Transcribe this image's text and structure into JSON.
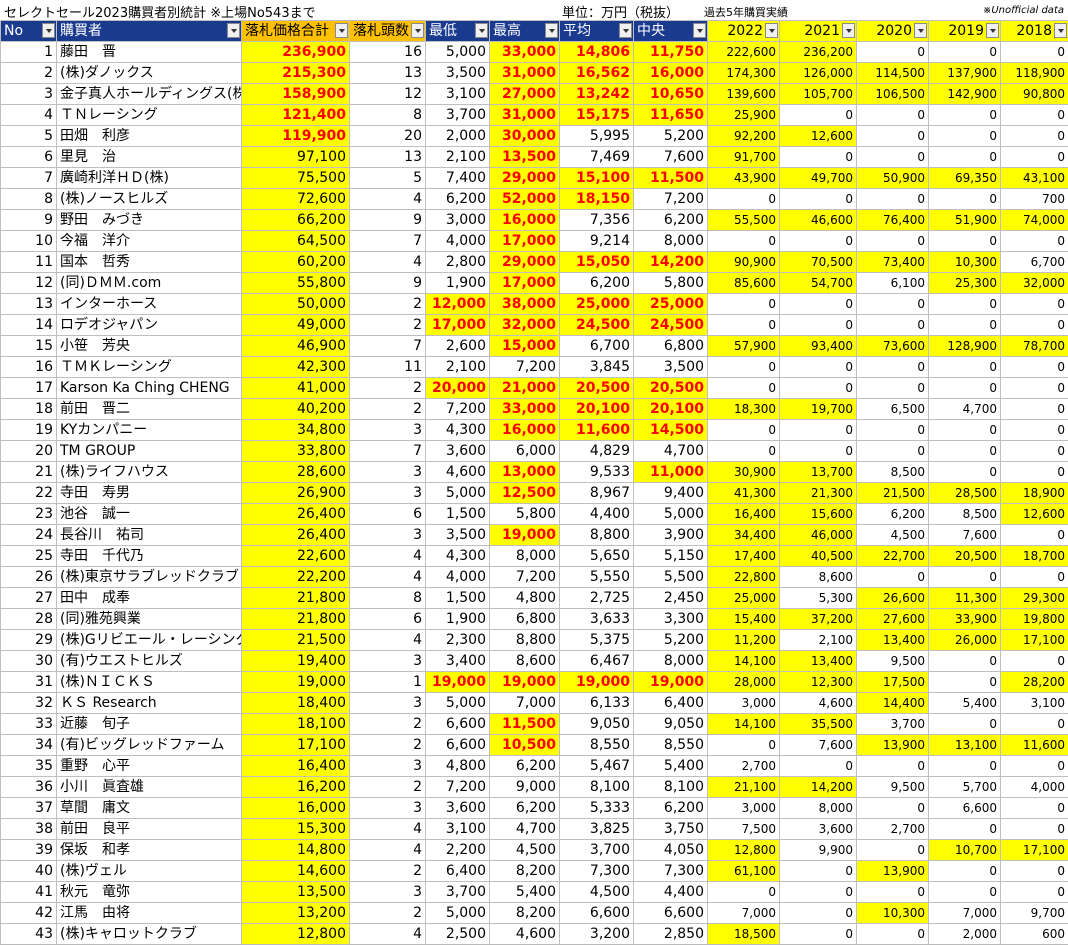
{
  "caption": {
    "title": "セレクトセール2023購買者別統計 ※上場No543まで",
    "unit": "単位：万円（税抜）",
    "hist_label": "過去5年購買実績",
    "note": "※Unofficial data"
  },
  "columns": [
    "No",
    "購買者",
    "落札価格合計",
    "落札頭数",
    "最低",
    "最高",
    "平均",
    "中央",
    "2022",
    "2021",
    "2020",
    "2019",
    "2018"
  ],
  "rows": [
    {
      "no": "1",
      "name": "藤田　晋",
      "total": "236,900",
      "count": "16",
      "min": "5,000",
      "max": "33,000",
      "avg": "14,806",
      "med": "11,750",
      "y2022": "222,600",
      "y2021": "236,200",
      "y2020": "0",
      "y2019": "0",
      "y2018": "0",
      "hl": [
        "total",
        "max",
        "avg",
        "med",
        "y2022",
        "y2021"
      ]
    },
    {
      "no": "2",
      "name": "(株)ダノックス",
      "total": "215,300",
      "count": "13",
      "min": "3,500",
      "max": "31,000",
      "avg": "16,562",
      "med": "16,000",
      "y2022": "174,300",
      "y2021": "126,000",
      "y2020": "114,500",
      "y2019": "137,900",
      "y2018": "118,900",
      "hl": [
        "total",
        "max",
        "avg",
        "med",
        "y2022",
        "y2021",
        "y2020",
        "y2019",
        "y2018"
      ]
    },
    {
      "no": "3",
      "name": "金子真人ホールディングス(株)",
      "total": "158,900",
      "count": "12",
      "min": "3,100",
      "max": "27,000",
      "avg": "13,242",
      "med": "10,650",
      "y2022": "139,600",
      "y2021": "105,700",
      "y2020": "106,500",
      "y2019": "142,900",
      "y2018": "90,800",
      "hl": [
        "total",
        "max",
        "avg",
        "med",
        "y2022",
        "y2021",
        "y2020",
        "y2019",
        "y2018"
      ]
    },
    {
      "no": "4",
      "name": "ＴＮレーシング",
      "total": "121,400",
      "count": "8",
      "min": "3,700",
      "max": "31,000",
      "avg": "15,175",
      "med": "11,650",
      "y2022": "25,900",
      "y2021": "0",
      "y2020": "0",
      "y2019": "0",
      "y2018": "0",
      "hl": [
        "total",
        "max",
        "avg",
        "med",
        "y2022"
      ]
    },
    {
      "no": "5",
      "name": "田畑　利彦",
      "total": "119,900",
      "count": "20",
      "min": "2,000",
      "max": "30,000",
      "avg": "5,995",
      "med": "5,200",
      "y2022": "92,200",
      "y2021": "12,600",
      "y2020": "0",
      "y2019": "0",
      "y2018": "0",
      "hl": [
        "total",
        "max",
        "y2022",
        "y2021"
      ]
    },
    {
      "no": "6",
      "name": "里見　治",
      "total": "97,100",
      "count": "13",
      "min": "2,100",
      "max": "13,500",
      "avg": "7,469",
      "med": "7,600",
      "y2022": "91,700",
      "y2021": "0",
      "y2020": "0",
      "y2019": "0",
      "y2018": "0",
      "hl": [
        "total",
        "max",
        "y2022"
      ]
    },
    {
      "no": "7",
      "name": "廣崎利洋ＨＤ(株)",
      "total": "75,500",
      "count": "5",
      "min": "7,400",
      "max": "29,000",
      "avg": "15,100",
      "med": "11,500",
      "y2022": "43,900",
      "y2021": "49,700",
      "y2020": "50,900",
      "y2019": "69,350",
      "y2018": "43,100",
      "hl": [
        "total",
        "max",
        "avg",
        "med",
        "y2022",
        "y2021",
        "y2020",
        "y2019",
        "y2018"
      ]
    },
    {
      "no": "8",
      "name": "(株)ノースヒルズ",
      "total": "72,600",
      "count": "4",
      "min": "6,200",
      "max": "52,000",
      "avg": "18,150",
      "med": "7,200",
      "y2022": "0",
      "y2021": "0",
      "y2020": "0",
      "y2019": "0",
      "y2018": "700",
      "hl": [
        "total",
        "max",
        "avg"
      ]
    },
    {
      "no": "9",
      "name": "野田　みづき",
      "total": "66,200",
      "count": "9",
      "min": "3,000",
      "max": "16,000",
      "avg": "7,356",
      "med": "6,200",
      "y2022": "55,500",
      "y2021": "46,600",
      "y2020": "76,400",
      "y2019": "51,900",
      "y2018": "74,000",
      "hl": [
        "total",
        "max",
        "y2022",
        "y2021",
        "y2020",
        "y2019",
        "y2018"
      ]
    },
    {
      "no": "10",
      "name": "今福　洋介",
      "total": "64,500",
      "count": "7",
      "min": "4,000",
      "max": "17,000",
      "avg": "9,214",
      "med": "8,000",
      "y2022": "0",
      "y2021": "0",
      "y2020": "0",
      "y2019": "0",
      "y2018": "0",
      "hl": [
        "total",
        "max"
      ]
    },
    {
      "no": "11",
      "name": "国本　哲秀",
      "total": "60,200",
      "count": "4",
      "min": "2,800",
      "max": "29,000",
      "avg": "15,050",
      "med": "14,200",
      "y2022": "90,900",
      "y2021": "70,500",
      "y2020": "73,400",
      "y2019": "10,300",
      "y2018": "6,700",
      "hl": [
        "total",
        "max",
        "avg",
        "med",
        "y2022",
        "y2021",
        "y2020",
        "y2019"
      ]
    },
    {
      "no": "12",
      "name": "(同)ＤＭＭ.com",
      "total": "55,800",
      "count": "9",
      "min": "1,900",
      "max": "17,000",
      "avg": "6,200",
      "med": "5,800",
      "y2022": "85,600",
      "y2021": "54,700",
      "y2020": "6,100",
      "y2019": "25,300",
      "y2018": "32,000",
      "hl": [
        "total",
        "max",
        "y2022",
        "y2021",
        "y2019",
        "y2018"
      ]
    },
    {
      "no": "13",
      "name": "インターホース",
      "total": "50,000",
      "count": "2",
      "min": "12,000",
      "max": "38,000",
      "avg": "25,000",
      "med": "25,000",
      "y2022": "0",
      "y2021": "0",
      "y2020": "0",
      "y2019": "0",
      "y2018": "0",
      "hl": [
        "total",
        "min",
        "max",
        "avg",
        "med"
      ]
    },
    {
      "no": "14",
      "name": "ロデオジャパン",
      "total": "49,000",
      "count": "2",
      "min": "17,000",
      "max": "32,000",
      "avg": "24,500",
      "med": "24,500",
      "y2022": "0",
      "y2021": "0",
      "y2020": "0",
      "y2019": "0",
      "y2018": "0",
      "hl": [
        "total",
        "min",
        "max",
        "avg",
        "med"
      ]
    },
    {
      "no": "15",
      "name": "小笹　芳央",
      "total": "46,900",
      "count": "7",
      "min": "2,600",
      "max": "15,000",
      "avg": "6,700",
      "med": "6,800",
      "y2022": "57,900",
      "y2021": "93,400",
      "y2020": "73,600",
      "y2019": "128,900",
      "y2018": "78,700",
      "hl": [
        "total",
        "max",
        "y2022",
        "y2021",
        "y2020",
        "y2019",
        "y2018"
      ]
    },
    {
      "no": "16",
      "name": "ＴＭＫレーシング",
      "total": "42,300",
      "count": "11",
      "min": "2,100",
      "max": "7,200",
      "avg": "3,845",
      "med": "3,500",
      "y2022": "0",
      "y2021": "0",
      "y2020": "0",
      "y2019": "0",
      "y2018": "0",
      "hl": [
        "total"
      ]
    },
    {
      "no": "17",
      "name": "Karson Ka Ching CHENG",
      "total": "41,000",
      "count": "2",
      "min": "20,000",
      "max": "21,000",
      "avg": "20,500",
      "med": "20,500",
      "y2022": "0",
      "y2021": "0",
      "y2020": "0",
      "y2019": "0",
      "y2018": "0",
      "hl": [
        "total",
        "min",
        "max",
        "avg",
        "med"
      ]
    },
    {
      "no": "18",
      "name": "前田　晋二",
      "total": "40,200",
      "count": "2",
      "min": "7,200",
      "max": "33,000",
      "avg": "20,100",
      "med": "20,100",
      "y2022": "18,300",
      "y2021": "19,700",
      "y2020": "6,500",
      "y2019": "4,700",
      "y2018": "0",
      "hl": [
        "total",
        "max",
        "avg",
        "med",
        "y2022",
        "y2021"
      ]
    },
    {
      "no": "19",
      "name": "KYカンパニー",
      "total": "34,800",
      "count": "3",
      "min": "4,300",
      "max": "16,000",
      "avg": "11,600",
      "med": "14,500",
      "y2022": "0",
      "y2021": "0",
      "y2020": "0",
      "y2019": "0",
      "y2018": "0",
      "hl": [
        "total",
        "max",
        "avg",
        "med"
      ]
    },
    {
      "no": "20",
      "name": "TM GROUP",
      "total": "33,800",
      "count": "7",
      "min": "3,600",
      "max": "6,000",
      "avg": "4,829",
      "med": "4,700",
      "y2022": "0",
      "y2021": "0",
      "y2020": "0",
      "y2019": "0",
      "y2018": "0",
      "hl": [
        "total"
      ]
    },
    {
      "no": "21",
      "name": "(株)ライフハウス",
      "total": "28,600",
      "count": "3",
      "min": "4,600",
      "max": "13,000",
      "avg": "9,533",
      "med": "11,000",
      "y2022": "30,900",
      "y2021": "13,700",
      "y2020": "8,500",
      "y2019": "0",
      "y2018": "0",
      "hl": [
        "total",
        "max",
        "med",
        "y2022",
        "y2021"
      ]
    },
    {
      "no": "22",
      "name": "寺田　寿男",
      "total": "26,900",
      "count": "3",
      "min": "5,000",
      "max": "12,500",
      "avg": "8,967",
      "med": "9,400",
      "y2022": "41,300",
      "y2021": "21,300",
      "y2020": "21,500",
      "y2019": "28,500",
      "y2018": "18,900",
      "hl": [
        "total",
        "max",
        "y2022",
        "y2021",
        "y2020",
        "y2019",
        "y2018"
      ]
    },
    {
      "no": "23",
      "name": "池谷　誠一",
      "total": "26,400",
      "count": "6",
      "min": "1,500",
      "max": "5,800",
      "avg": "4,400",
      "med": "5,000",
      "y2022": "16,400",
      "y2021": "15,600",
      "y2020": "6,200",
      "y2019": "8,500",
      "y2018": "12,600",
      "hl": [
        "total",
        "y2022",
        "y2021",
        "y2018"
      ]
    },
    {
      "no": "24",
      "name": "長谷川　祐司",
      "total": "26,400",
      "count": "3",
      "min": "3,500",
      "max": "19,000",
      "avg": "8,800",
      "med": "3,900",
      "y2022": "34,400",
      "y2021": "46,000",
      "y2020": "4,500",
      "y2019": "7,600",
      "y2018": "0",
      "hl": [
        "total",
        "max",
        "y2022",
        "y2021"
      ]
    },
    {
      "no": "25",
      "name": "寺田　千代乃",
      "total": "22,600",
      "count": "4",
      "min": "4,300",
      "max": "8,000",
      "avg": "5,650",
      "med": "5,150",
      "y2022": "17,400",
      "y2021": "40,500",
      "y2020": "22,700",
      "y2019": "20,500",
      "y2018": "18,700",
      "hl": [
        "total",
        "y2022",
        "y2021",
        "y2020",
        "y2019",
        "y2018"
      ]
    },
    {
      "no": "26",
      "name": "(株)東京サラブレッドクラブ",
      "total": "22,200",
      "count": "4",
      "min": "4,000",
      "max": "7,200",
      "avg": "5,550",
      "med": "5,500",
      "y2022": "22,800",
      "y2021": "8,600",
      "y2020": "0",
      "y2019": "0",
      "y2018": "0",
      "hl": [
        "total",
        "y2022"
      ]
    },
    {
      "no": "27",
      "name": "田中　成奉",
      "total": "21,800",
      "count": "8",
      "min": "1,500",
      "max": "4,800",
      "avg": "2,725",
      "med": "2,450",
      "y2022": "25,000",
      "y2021": "5,300",
      "y2020": "26,600",
      "y2019": "11,300",
      "y2018": "29,300",
      "hl": [
        "total",
        "y2022",
        "y2020",
        "y2019",
        "y2018"
      ]
    },
    {
      "no": "28",
      "name": "(同)雅苑興業",
      "total": "21,800",
      "count": "6",
      "min": "1,900",
      "max": "6,800",
      "avg": "3,633",
      "med": "3,300",
      "y2022": "15,400",
      "y2021": "37,200",
      "y2020": "27,600",
      "y2019": "33,900",
      "y2018": "19,800",
      "hl": [
        "total",
        "y2022",
        "y2021",
        "y2020",
        "y2019",
        "y2018"
      ]
    },
    {
      "no": "29",
      "name": "(株)Gリビエール・レーシング",
      "total": "21,500",
      "count": "4",
      "min": "2,300",
      "max": "8,800",
      "avg": "5,375",
      "med": "5,200",
      "y2022": "11,200",
      "y2021": "2,100",
      "y2020": "13,400",
      "y2019": "26,000",
      "y2018": "17,100",
      "hl": [
        "total",
        "y2022",
        "y2020",
        "y2019",
        "y2018"
      ]
    },
    {
      "no": "30",
      "name": "(有)ウエストヒルズ",
      "total": "19,400",
      "count": "3",
      "min": "3,400",
      "max": "8,600",
      "avg": "6,467",
      "med": "8,000",
      "y2022": "14,100",
      "y2021": "13,400",
      "y2020": "9,500",
      "y2019": "0",
      "y2018": "0",
      "hl": [
        "total",
        "y2022",
        "y2021"
      ]
    },
    {
      "no": "31",
      "name": "(株)ＮＩＣＫＳ",
      "total": "19,000",
      "count": "1",
      "min": "19,000",
      "max": "19,000",
      "avg": "19,000",
      "med": "19,000",
      "y2022": "28,000",
      "y2021": "12,300",
      "y2020": "17,500",
      "y2019": "0",
      "y2018": "28,200",
      "hl": [
        "total",
        "min",
        "max",
        "avg",
        "med",
        "y2022",
        "y2021",
        "y2020",
        "y2018"
      ]
    },
    {
      "no": "32",
      "name": "ＫＳ Research",
      "total": "18,400",
      "count": "3",
      "min": "5,000",
      "max": "7,000",
      "avg": "6,133",
      "med": "6,400",
      "y2022": "3,000",
      "y2021": "4,600",
      "y2020": "14,400",
      "y2019": "5,400",
      "y2018": "3,100",
      "hl": [
        "total",
        "y2020"
      ]
    },
    {
      "no": "33",
      "name": "近藤　旬子",
      "total": "18,100",
      "count": "2",
      "min": "6,600",
      "max": "11,500",
      "avg": "9,050",
      "med": "9,050",
      "y2022": "14,100",
      "y2021": "35,500",
      "y2020": "3,700",
      "y2019": "0",
      "y2018": "0",
      "hl": [
        "total",
        "max",
        "y2022",
        "y2021"
      ]
    },
    {
      "no": "34",
      "name": "(有)ビッグレッドファーム",
      "total": "17,100",
      "count": "2",
      "min": "6,600",
      "max": "10,500",
      "avg": "8,550",
      "med": "8,550",
      "y2022": "0",
      "y2021": "7,600",
      "y2020": "13,900",
      "y2019": "13,100",
      "y2018": "11,600",
      "hl": [
        "total",
        "max",
        "y2020",
        "y2019",
        "y2018"
      ]
    },
    {
      "no": "35",
      "name": "重野　心平",
      "total": "16,400",
      "count": "3",
      "min": "4,800",
      "max": "6,200",
      "avg": "5,467",
      "med": "5,400",
      "y2022": "2,700",
      "y2021": "0",
      "y2020": "0",
      "y2019": "0",
      "y2018": "0",
      "hl": [
        "total"
      ]
    },
    {
      "no": "36",
      "name": "小川　眞査雄",
      "total": "16,200",
      "count": "2",
      "min": "7,200",
      "max": "9,000",
      "avg": "8,100",
      "med": "8,100",
      "y2022": "21,100",
      "y2021": "14,200",
      "y2020": "9,500",
      "y2019": "5,700",
      "y2018": "4,000",
      "hl": [
        "total",
        "y2022",
        "y2021"
      ]
    },
    {
      "no": "37",
      "name": "草間　庸文",
      "total": "16,000",
      "count": "3",
      "min": "3,600",
      "max": "6,200",
      "avg": "5,333",
      "med": "6,200",
      "y2022": "3,000",
      "y2021": "8,000",
      "y2020": "0",
      "y2019": "6,600",
      "y2018": "0",
      "hl": [
        "total"
      ]
    },
    {
      "no": "38",
      "name": "前田　良平",
      "total": "15,300",
      "count": "4",
      "min": "3,100",
      "max": "4,700",
      "avg": "3,825",
      "med": "3,750",
      "y2022": "7,500",
      "y2021": "3,600",
      "y2020": "2,700",
      "y2019": "0",
      "y2018": "0",
      "hl": [
        "total"
      ]
    },
    {
      "no": "39",
      "name": "保坂　和孝",
      "total": "14,800",
      "count": "4",
      "min": "2,200",
      "max": "4,500",
      "avg": "3,700",
      "med": "4,050",
      "y2022": "12,800",
      "y2021": "9,900",
      "y2020": "0",
      "y2019": "10,700",
      "y2018": "17,100",
      "hl": [
        "total",
        "y2022",
        "y2019",
        "y2018"
      ]
    },
    {
      "no": "40",
      "name": "(株)ヴェル",
      "total": "14,600",
      "count": "2",
      "min": "6,400",
      "max": "8,200",
      "avg": "7,300",
      "med": "7,300",
      "y2022": "61,100",
      "y2021": "0",
      "y2020": "13,900",
      "y2019": "0",
      "y2018": "0",
      "hl": [
        "total",
        "y2022",
        "y2020"
      ]
    },
    {
      "no": "41",
      "name": "秋元　竜弥",
      "total": "13,500",
      "count": "3",
      "min": "3,700",
      "max": "5,400",
      "avg": "4,500",
      "med": "4,400",
      "y2022": "0",
      "y2021": "0",
      "y2020": "0",
      "y2019": "0",
      "y2018": "0",
      "hl": [
        "total"
      ]
    },
    {
      "no": "42",
      "name": "江馬　由将",
      "total": "13,200",
      "count": "2",
      "min": "5,000",
      "max": "8,200",
      "avg": "6,600",
      "med": "6,600",
      "y2022": "7,000",
      "y2021": "0",
      "y2020": "10,300",
      "y2019": "7,000",
      "y2018": "9,700",
      "hl": [
        "total",
        "y2020"
      ]
    },
    {
      "no": "43",
      "name": "(株)キャロットクラブ",
      "total": "12,800",
      "count": "4",
      "min": "2,500",
      "max": "4,600",
      "avg": "3,200",
      "med": "2,850",
      "y2022": "18,500",
      "y2021": "0",
      "y2020": "0",
      "y2019": "2,000",
      "y2018": "600",
      "hl": [
        "total",
        "y2022"
      ]
    }
  ],
  "red_cols": [
    "total",
    "min",
    "max",
    "avg",
    "med"
  ],
  "red_rank_limit": 5,
  "colors": {
    "header_blue": "#1a3a8f",
    "highlight": "#ffff00",
    "header_orange": "#ffc000",
    "red": "#ff0000"
  }
}
